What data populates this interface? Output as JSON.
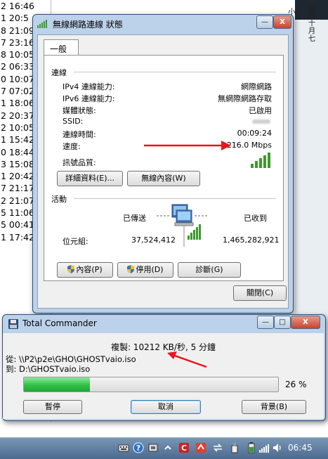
{
  "background_list": {
    "rows": [
      "2 16:46",
      "1 20:5",
      "8 21:09",
      "7 23:16",
      "8 10:05",
      "2 06:33",
      "0 10:07",
      "7 07:02",
      "1 18:06",
      "2 20:37",
      "2 10:05",
      "1 15:42",
      "0 18:44",
      "3 15:08",
      "1 20:42",
      "7 21:17",
      "2 21:07",
      "5 11:06",
      "5 00:41",
      "1 17:42"
    ]
  },
  "calendar_side": {
    "small_text": "小",
    "chars": [
      "農",
      "曆",
      "十",
      "月",
      "七"
    ]
  },
  "status_dialog": {
    "title": "無線網路連線 狀態",
    "tab": "一般",
    "connection_heading": "連線",
    "rows": [
      {
        "label": "IPv4 連線能力:",
        "value": "網際網路"
      },
      {
        "label": "IPv6 連線能力:",
        "value": "無網際網路存取"
      },
      {
        "label": "媒體狀態:",
        "value": "已啟用"
      },
      {
        "label": "SSID:",
        "value": ""
      },
      {
        "label": "連線時間:",
        "value": "00:09:24"
      },
      {
        "label": "速度:",
        "value": "216.0 Mbps"
      }
    ],
    "signal_label": "訊號品質:",
    "details_button": "詳細資料(E)...",
    "wireless_props_button": "無線內容(W)",
    "activity_heading": "活動",
    "sent_label": "已傳送",
    "received_label": "已收到",
    "bytes_label": "位元組:",
    "bytes_sent": "37,524,412",
    "bytes_received": "1,465,282,921",
    "properties_button": "內容(P)",
    "disable_button": "停用(D)",
    "diagnose_button": "診斷(G)",
    "close_button": "關閉(C)",
    "controls": {
      "minimize": "—",
      "close": "X"
    }
  },
  "copy_dialog": {
    "title": "Total Commander",
    "status_line": "複製: 10212 KB/秒, 5 分鐘",
    "from_line": "從: \\\\P2\\p2e\\GHO\\GHOSTvaio.iso",
    "to_line": "到: D:\\GHOSTvaio.iso",
    "progress": 0.26,
    "progress_text": "26 %",
    "pause_button": "暫停",
    "cancel_button": "取消",
    "background_button": "背景(B)",
    "controls": {
      "minimize": "—",
      "maximize": "□",
      "close": "X"
    }
  },
  "taskbar": {
    "clock": "06:45"
  },
  "colors": {
    "arrow": "#e8141e",
    "progress": "#2fc244",
    "signal": "#3c9a2c"
  }
}
